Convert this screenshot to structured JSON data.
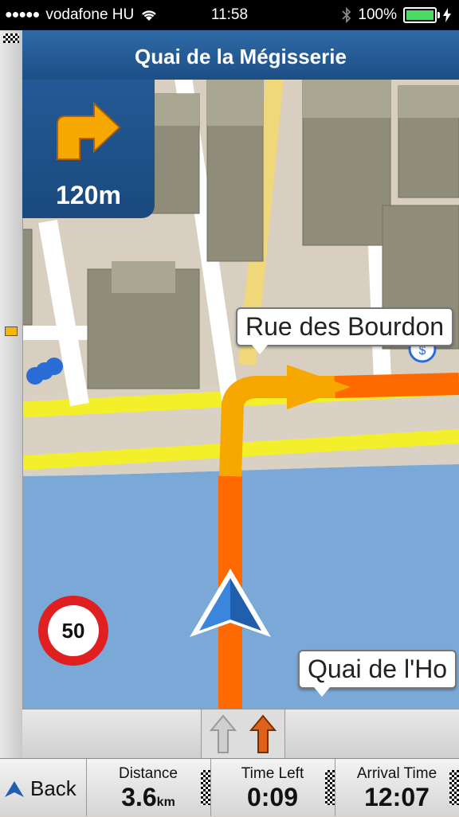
{
  "status_bar": {
    "carrier": "vodafone HU",
    "time": "11:58",
    "battery": "100%"
  },
  "navigation": {
    "current_street": "Quai de la Mégisserie",
    "next_turn": {
      "direction": "right",
      "distance": "120m",
      "icon": "turn-right-arrow-icon"
    },
    "street_labels": [
      "Rue des Bourdon",
      "Quai de l'Ho"
    ],
    "speed_limit": "50"
  },
  "bottom_bar": {
    "back_label": "Back",
    "distance": {
      "label": "Distance",
      "value": "3.6",
      "unit": "km"
    },
    "time_left": {
      "label": "Time Left",
      "value": "0:09"
    },
    "arrival_time": {
      "label": "Arrival Time",
      "value": "12:07"
    }
  },
  "colors": {
    "route": "#ff6a00",
    "route_highlight": "#f6a800",
    "header": "#1d4f86",
    "water": "#7aa9d8",
    "road_yellow": "#f3ef2a"
  }
}
